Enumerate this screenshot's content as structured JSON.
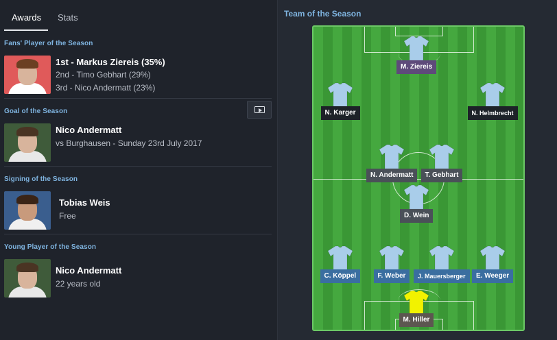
{
  "tabs": [
    {
      "label": "Awards",
      "active": true
    },
    {
      "label": "Stats",
      "active": false
    }
  ],
  "sections": {
    "fans": {
      "title": "Fans' Player of the Season",
      "winner": "1st - Markus Ziereis (35%)",
      "second": "2nd - Timo Gebhart (29%)",
      "third": "3rd - Nico Andermatt (23%)"
    },
    "goal": {
      "title": "Goal of the Season",
      "player": "Nico Andermatt",
      "detail": "vs Burghausen - Sunday 23rd July 2017"
    },
    "signing": {
      "title": "Signing of the Season",
      "player": "Tobias Weis",
      "detail": "Free"
    },
    "young": {
      "title": "Young Player of the Season",
      "player": "Nico Andermatt",
      "detail": "22 years old"
    }
  },
  "team": {
    "title": "Team of the Season",
    "players": [
      {
        "name": "M. Ziereis",
        "tag_color": "#5e4a7a"
      },
      {
        "name": "N. Karger",
        "tag_color": "#1d2228"
      },
      {
        "name": "N. Helmbrecht",
        "tag_color": "#1d2228"
      },
      {
        "name": "N. Andermatt",
        "tag_color": "#4a5058"
      },
      {
        "name": "T. Gebhart",
        "tag_color": "#4a5058"
      },
      {
        "name": "D. Wein",
        "tag_color": "#4a5058"
      },
      {
        "name": "C. Köppel",
        "tag_color": "#3a6ea0"
      },
      {
        "name": "F. Weber",
        "tag_color": "#3a6ea0"
      },
      {
        "name": "J. Mauersberger",
        "tag_color": "#3a6ea0"
      },
      {
        "name": "E. Weeger",
        "tag_color": "#3a6ea0"
      },
      {
        "name": "M. Hiller",
        "tag_color": "#5c5650"
      }
    ]
  },
  "icons": {
    "video": "tv-play-icon",
    "kit": "shirt-icon",
    "keeper_kit": "goalkeeper-shirt-icon"
  },
  "colors": {
    "accent": "#7fb4e0",
    "pitch": "#45a83f",
    "outfield_kit": "#a9cdea",
    "keeper_kit": "#f2f200"
  }
}
